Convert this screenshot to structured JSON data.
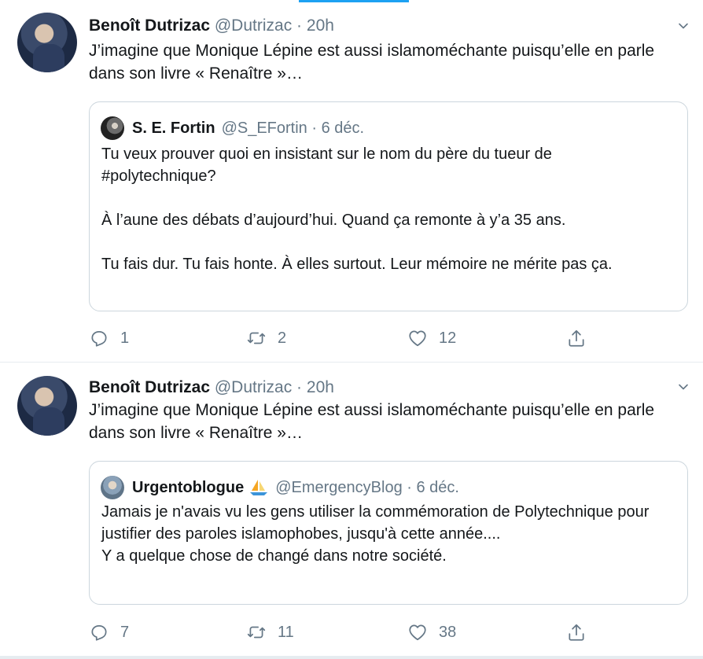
{
  "tweets": [
    {
      "author_name": "Benoît Dutrizac",
      "author_handle": "@Dutrizac",
      "separator": "·",
      "time": "20h",
      "text": "J’imagine que Monique Lépine est aussi islamoméchante puisqu’elle en parle dans son livre « Renaître »…",
      "quote": {
        "name": "S. E. Fortin",
        "handle": "@S_EFortin",
        "separator": "·",
        "date": "6 déc.",
        "paragraphs": [
          "Tu veux prouver quoi en insistant sur le nom du père du tueur de #polytechnique?",
          "À l’aune des débats d’aujourd’hui. Quand ça remonte à y’a 35 ans.",
          "Tu fais dur. Tu fais honte. À elles surtout. Leur mémoire ne mérite pas ça."
        ]
      },
      "replies": "1",
      "retweets": "2",
      "likes": "12"
    },
    {
      "author_name": "Benoît Dutrizac",
      "author_handle": "@Dutrizac",
      "separator": "·",
      "time": "20h",
      "text": "J’imagine que Monique Lépine est aussi islamoméchante puisqu’elle en parle dans son livre « Renaître »…",
      "quote": {
        "name": "Urgentoblogue",
        "handle": "@EmergencyBlog",
        "separator": "·",
        "date": "6 déc.",
        "paragraphs": [
          "Jamais je n'avais vu les gens utiliser la commémoration de Polytechnique pour justifier des paroles islamophobes, jusqu'à cette année....",
          "Y a quelque chose de changé dans notre société."
        ]
      },
      "replies": "7",
      "retweets": "11",
      "likes": "38"
    }
  ],
  "icons": {
    "reply": "reply-icon",
    "retweet": "retweet-icon",
    "like": "heart-icon",
    "share": "share-icon",
    "menu": "chevron-down-icon",
    "emoji": "sailboat-icon"
  },
  "colors": {
    "accent": "#1da1f2",
    "secondary_text": "#657786",
    "border": "#ccd6dd"
  }
}
